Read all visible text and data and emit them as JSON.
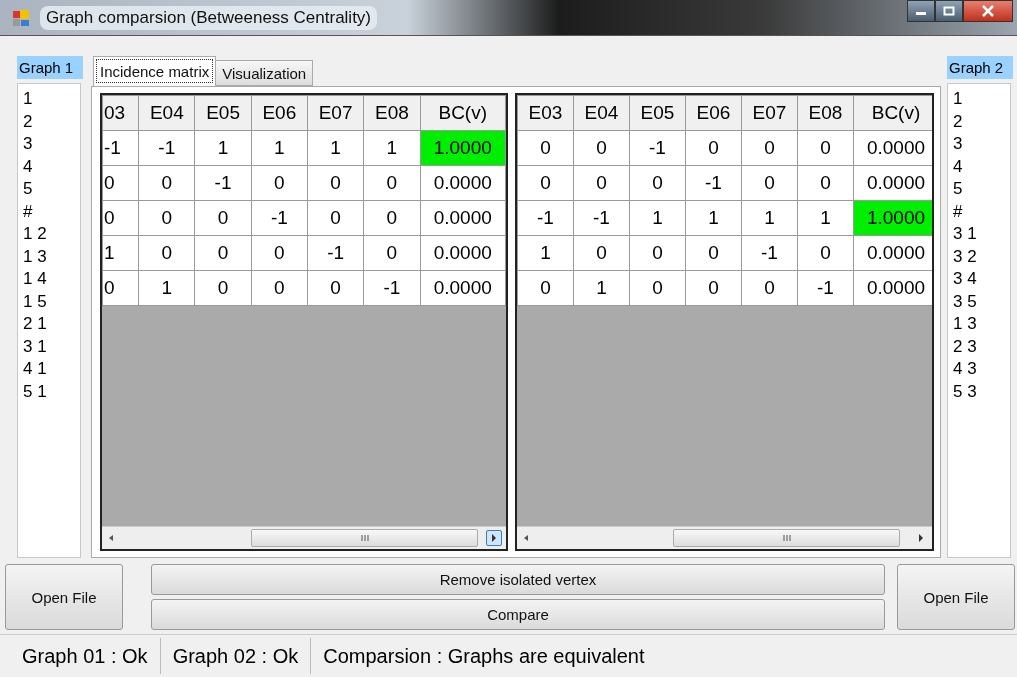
{
  "window": {
    "title": "Graph comparsion (Betweeness Centrality)"
  },
  "graph_lists": [
    {
      "label": "Graph 1",
      "items": [
        "1",
        "2",
        "3",
        "4",
        "5",
        "#",
        "1 2",
        "1 3",
        "1 4",
        "1 5",
        "2 1",
        "3 1",
        "4 1",
        "5 1"
      ]
    },
    {
      "label": "Graph 2",
      "items": [
        "1",
        "2",
        "3",
        "4",
        "5",
        "#",
        "3 1",
        "3 2",
        "3 4",
        "3 5",
        "1 3",
        "2 3",
        "4 3",
        "5 3"
      ]
    }
  ],
  "tabs": [
    {
      "label": "Incidence matrix",
      "selected": true
    },
    {
      "label": "Visualization",
      "selected": false
    }
  ],
  "grids": [
    {
      "columns": [
        "03",
        "E04",
        "E05",
        "E06",
        "E07",
        "E08",
        "BC(v)"
      ],
      "rows": [
        {
          "cells": [
            "-1",
            "-1",
            "1",
            "1",
            "1",
            "1"
          ],
          "bc": "1.0000",
          "highlight": true
        },
        {
          "cells": [
            "0",
            "0",
            "-1",
            "0",
            "0",
            "0"
          ],
          "bc": "0.0000",
          "highlight": false
        },
        {
          "cells": [
            "0",
            "0",
            "0",
            "-1",
            "0",
            "0"
          ],
          "bc": "0.0000",
          "highlight": false
        },
        {
          "cells": [
            "1",
            "0",
            "0",
            "0",
            "-1",
            "0"
          ],
          "bc": "0.0000",
          "highlight": false
        },
        {
          "cells": [
            "0",
            "1",
            "0",
            "0",
            "0",
            "-1"
          ],
          "bc": "0.0000",
          "highlight": false
        }
      ]
    },
    {
      "columns": [
        "E03",
        "E04",
        "E05",
        "E06",
        "E07",
        "E08",
        "BC(v)"
      ],
      "rows": [
        {
          "cells": [
            "0",
            "0",
            "-1",
            "0",
            "0",
            "0"
          ],
          "bc": "0.0000",
          "highlight": false
        },
        {
          "cells": [
            "0",
            "0",
            "0",
            "-1",
            "0",
            "0"
          ],
          "bc": "0.0000",
          "highlight": false
        },
        {
          "cells": [
            "-1",
            "-1",
            "1",
            "1",
            "1",
            "1"
          ],
          "bc": "1.0000",
          "highlight": true
        },
        {
          "cells": [
            "1",
            "0",
            "0",
            "0",
            "-1",
            "0"
          ],
          "bc": "0.0000",
          "highlight": false
        },
        {
          "cells": [
            "0",
            "1",
            "0",
            "0",
            "0",
            "-1"
          ],
          "bc": "0.0000",
          "highlight": false
        }
      ]
    }
  ],
  "buttons": {
    "open_left": "Open File",
    "remove": "Remove isolated vertex",
    "compare": "Compare",
    "open_right": "Open File"
  },
  "status_bar": [
    "Graph 01 : Ok",
    "Graph 02 : Ok",
    "Comparsion : Graphs are equivalent"
  ]
}
